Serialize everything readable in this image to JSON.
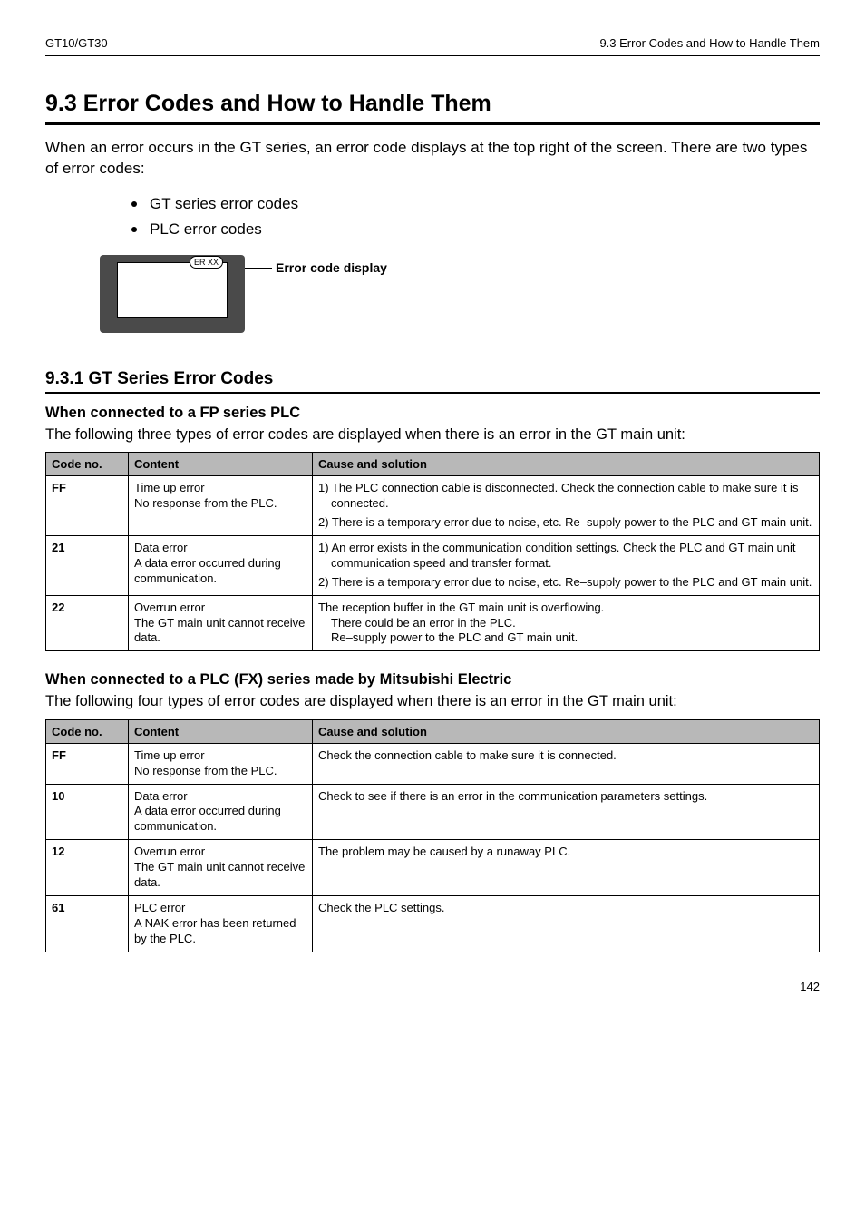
{
  "header": {
    "left": "GT10/GT30",
    "right": "9.3   Error Codes and How to Handle Them"
  },
  "title": "9.3    Error Codes and How to Handle Them",
  "intro": "When an error occurs in the GT series, an error code displays at the top right of the screen. There are two types of error codes:",
  "bullets": [
    "GT series error codes",
    "PLC error codes"
  ],
  "diagram": {
    "bubble": "ER XX",
    "label": "Error code display"
  },
  "subsection": "9.3.1      GT Series Error Codes",
  "fp": {
    "heading": "When connected to a FP series PLC",
    "paragraph": "The following three types of error codes are displayed when there is an error in the GT main unit:",
    "headers": [
      "Code no.",
      "Content",
      "Cause and solution"
    ],
    "rows": [
      {
        "code": "FF",
        "content": "Time up error\nNo response from the PLC.",
        "causes": [
          "1) The PLC connection cable is disconnected.  Check the connection cable to make sure it is connected.",
          "2) There is a temporary error due to noise, etc.  Re–supply power to the PLC and GT main unit."
        ]
      },
      {
        "code": "21",
        "content": "Data error\nA data error occurred during communication.",
        "causes": [
          "1) An error exists in the communication condition settings. Check the PLC and GT main unit communication speed and transfer format.",
          "2) There is a temporary error due to noise, etc.  Re–supply power to the PLC and GT main unit."
        ]
      },
      {
        "code": "22",
        "content": "Overrun error\nThe GT main unit cannot receive data.",
        "causes": [
          "The reception buffer in the GT main unit is overflowing.\nThere could be an error in the PLC.\nRe–supply power to the PLC and GT main unit."
        ]
      }
    ]
  },
  "fx": {
    "heading": "When connected to a PLC (FX) series made by Mitsubishi Electric",
    "paragraph": "The following four types of error codes are displayed when there is an error in the GT main unit:",
    "headers": [
      "Code no.",
      "Content",
      "Cause and solution"
    ],
    "rows": [
      {
        "code": "FF",
        "content": "Time up error\nNo response from the PLC.",
        "cause": "Check the connection cable to make sure it is connected."
      },
      {
        "code": "10",
        "content": "Data error\nA data error occurred during communication.",
        "cause": "Check to see if there is an error in the communication parameters settings."
      },
      {
        "code": "12",
        "content": "Overrun error\nThe GT main unit cannot receive data.",
        "cause": "The problem may be caused by a runaway PLC."
      },
      {
        "code": "61",
        "content": "PLC error\nA NAK error has been returned by the PLC.",
        "cause": "Check the PLC settings."
      }
    ]
  },
  "footer": "142"
}
